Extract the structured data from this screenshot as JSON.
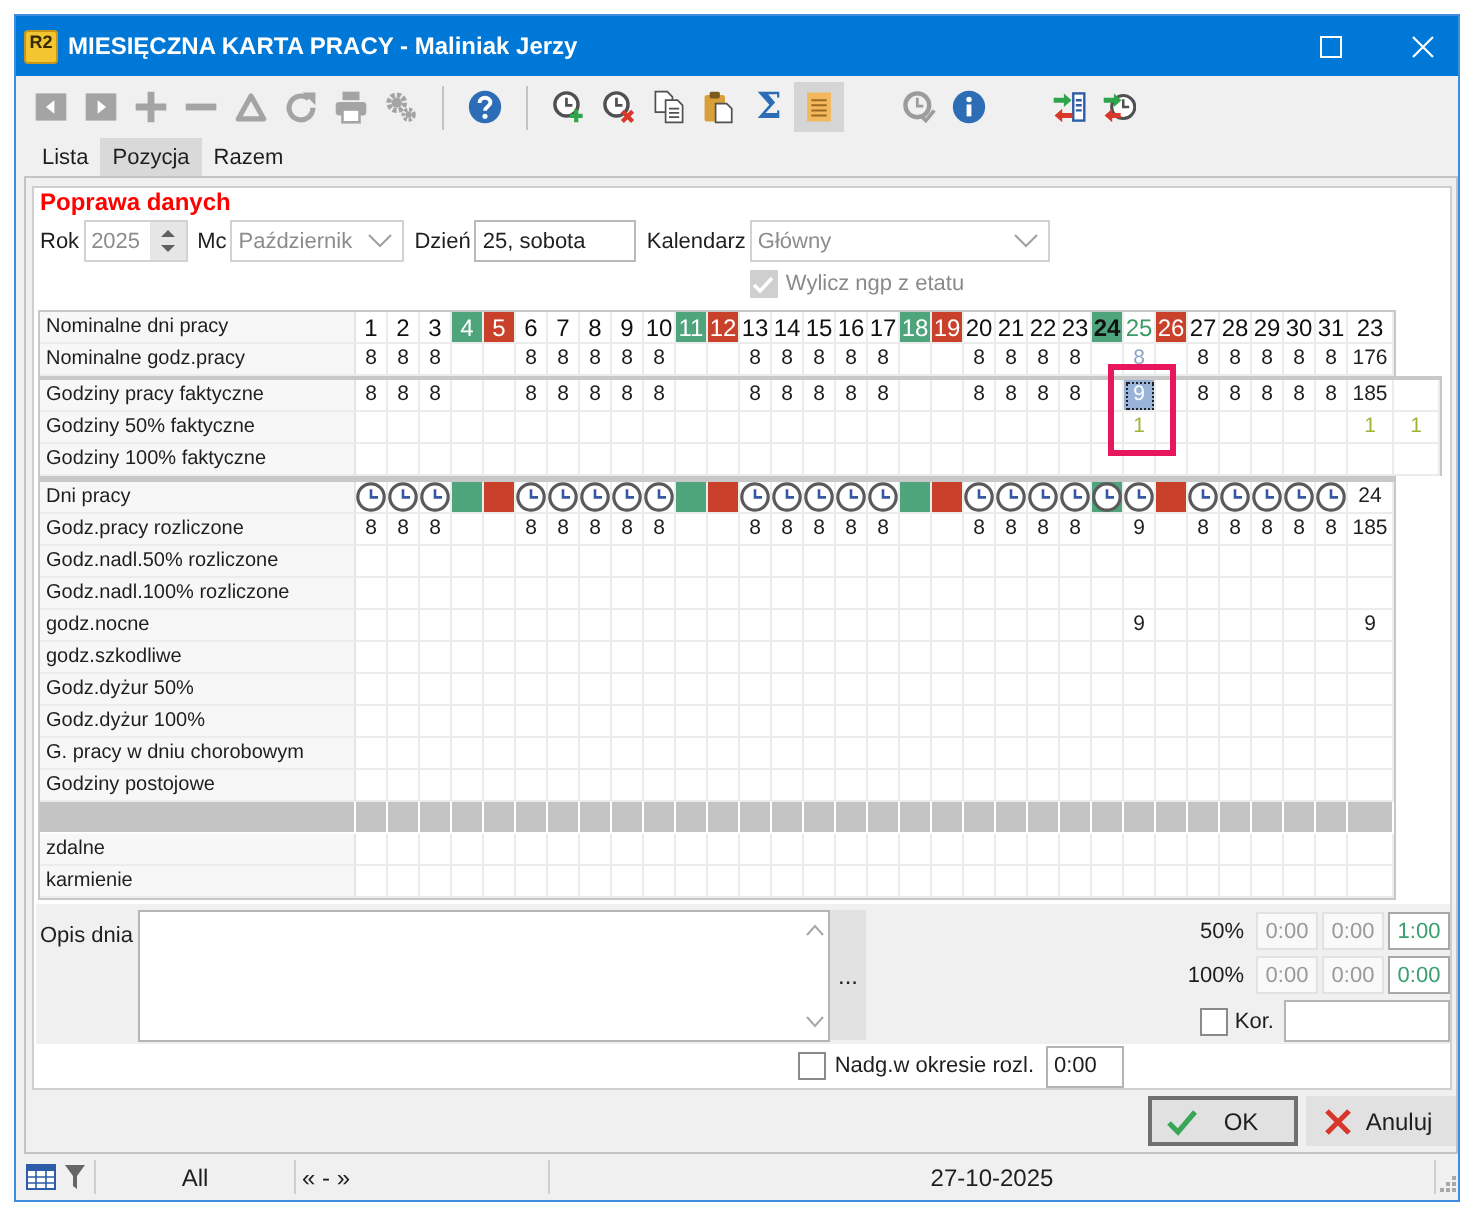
{
  "window": {
    "logo": "R2",
    "title": "MIESIĘCZNA KARTA PRACY - Maliniak Jerzy"
  },
  "toolbar": [
    {
      "kind": "prev",
      "disabled": true,
      "on": false
    },
    {
      "kind": "next",
      "disabled": true,
      "on": false
    },
    {
      "kind": "add",
      "disabled": true,
      "on": false
    },
    {
      "kind": "remove",
      "disabled": true,
      "on": false
    },
    {
      "kind": "delta",
      "disabled": true,
      "on": false
    },
    {
      "kind": "refresh",
      "disabled": true,
      "on": false
    },
    {
      "kind": "print",
      "disabled": true,
      "on": false
    },
    {
      "kind": "gears",
      "disabled": true,
      "on": false
    },
    {
      "kind": "separator"
    },
    {
      "kind": "help",
      "disabled": false,
      "on": false
    },
    {
      "kind": "separator"
    },
    {
      "kind": "clock_add",
      "disabled": false,
      "on": false
    },
    {
      "kind": "clock_remove",
      "disabled": false,
      "on": false
    },
    {
      "kind": "copy",
      "disabled": false,
      "on": false
    },
    {
      "kind": "paste",
      "disabled": false,
      "on": false
    },
    {
      "kind": "symbol",
      "text": "Σ",
      "disabled": false,
      "on": false
    },
    {
      "kind": "notes",
      "disabled": false,
      "on": true
    },
    {
      "kind": "spacer"
    },
    {
      "kind": "clock_check",
      "disabled": true,
      "on": false
    },
    {
      "kind": "info",
      "disabled": false,
      "on": false
    },
    {
      "kind": "spacer"
    },
    {
      "kind": "transfer_list",
      "disabled": false,
      "on": false
    },
    {
      "kind": "transfer_clock",
      "disabled": false,
      "on": false
    }
  ],
  "tabs": [
    {
      "label": "Lista",
      "selected": false
    },
    {
      "label": "Pozycja",
      "selected": true
    },
    {
      "label": "Razem",
      "selected": false
    }
  ],
  "form": {
    "heading": "Poprawa danych",
    "year": {
      "label": "Rok",
      "value": "2025",
      "disabled": true
    },
    "month": {
      "label": "Mc",
      "value": "Październik",
      "disabled": true
    },
    "day": {
      "label": "Dzień",
      "value": "25, sobota",
      "disabled": false
    },
    "calendar": {
      "label": "Kalendarz",
      "value": "Główny",
      "disabled": true
    },
    "ngp": {
      "label": "Wylicz ngp z etatu",
      "checked": true,
      "disabled": true
    }
  },
  "grid": {
    "days": [
      {
        "label": "1",
        "kind": "work",
        "selected": false,
        "marked": false,
        "hours": {
          "nominal": "8",
          "actual": "8",
          "settled": "8"
        }
      },
      {
        "label": "2",
        "kind": "work",
        "selected": false,
        "marked": false,
        "hours": {
          "nominal": "8",
          "actual": "8",
          "settled": "8"
        }
      },
      {
        "label": "3",
        "kind": "work",
        "selected": false,
        "marked": false,
        "hours": {
          "nominal": "8",
          "actual": "8",
          "settled": "8"
        }
      },
      {
        "label": "4",
        "kind": "free",
        "selected": false,
        "marked": false
      },
      {
        "label": "5",
        "kind": "holiday",
        "selected": false,
        "marked": false
      },
      {
        "label": "6",
        "kind": "work",
        "selected": false,
        "marked": false,
        "hours": {
          "nominal": "8",
          "actual": "8",
          "settled": "8"
        }
      },
      {
        "label": "7",
        "kind": "work",
        "selected": false,
        "marked": false,
        "hours": {
          "nominal": "8",
          "actual": "8",
          "settled": "8"
        }
      },
      {
        "label": "8",
        "kind": "work",
        "selected": false,
        "marked": false,
        "hours": {
          "nominal": "8",
          "actual": "8",
          "settled": "8"
        }
      },
      {
        "label": "9",
        "kind": "work",
        "selected": false,
        "marked": false,
        "hours": {
          "nominal": "8",
          "actual": "8",
          "settled": "8"
        }
      },
      {
        "label": "10",
        "kind": "work",
        "selected": false,
        "marked": false,
        "hours": {
          "nominal": "8",
          "actual": "8",
          "settled": "8"
        }
      },
      {
        "label": "11",
        "kind": "free",
        "selected": false,
        "marked": false
      },
      {
        "label": "12",
        "kind": "holiday",
        "selected": false,
        "marked": false
      },
      {
        "label": "13",
        "kind": "work",
        "selected": false,
        "marked": false,
        "hours": {
          "nominal": "8",
          "actual": "8",
          "settled": "8"
        }
      },
      {
        "label": "14",
        "kind": "work",
        "selected": false,
        "marked": false,
        "hours": {
          "nominal": "8",
          "actual": "8",
          "settled": "8"
        }
      },
      {
        "label": "15",
        "kind": "work",
        "selected": false,
        "marked": false,
        "hours": {
          "nominal": "8",
          "actual": "8",
          "settled": "8"
        }
      },
      {
        "label": "16",
        "kind": "work",
        "selected": false,
        "marked": false,
        "hours": {
          "nominal": "8",
          "actual": "8",
          "settled": "8"
        }
      },
      {
        "label": "17",
        "kind": "work",
        "selected": false,
        "marked": false,
        "hours": {
          "nominal": "8",
          "actual": "8",
          "settled": "8"
        }
      },
      {
        "label": "18",
        "kind": "free",
        "selected": false,
        "marked": false
      },
      {
        "label": "19",
        "kind": "holiday",
        "selected": false,
        "marked": false
      },
      {
        "label": "20",
        "kind": "work",
        "selected": false,
        "marked": false,
        "hours": {
          "nominal": "8",
          "actual": "8",
          "settled": "8"
        }
      },
      {
        "label": "21",
        "kind": "work",
        "selected": false,
        "marked": false,
        "hours": {
          "nominal": "8",
          "actual": "8",
          "settled": "8"
        }
      },
      {
        "label": "22",
        "kind": "work",
        "selected": false,
        "marked": false,
        "hours": {
          "nominal": "8",
          "actual": "8",
          "settled": "8"
        }
      },
      {
        "label": "23",
        "kind": "work",
        "selected": false,
        "marked": false,
        "hours": {
          "nominal": "8",
          "actual": "8",
          "settled": "8"
        }
      },
      {
        "label": "24",
        "kind": "swap_free",
        "selected": false,
        "marked": false
      },
      {
        "label": "25",
        "kind": "work",
        "selected": true,
        "marked": true,
        "hours": {
          "nominal": {
            "text": "8",
            "dim": true
          },
          "actual": {
            "text": "9",
            "selected": true
          },
          "overtime": "1",
          "settled": "9",
          "night": "9"
        }
      },
      {
        "label": "26",
        "kind": "holiday",
        "selected": false,
        "marked": false
      },
      {
        "label": "27",
        "kind": "work",
        "selected": false,
        "marked": false,
        "hours": {
          "nominal": "8",
          "actual": "8",
          "settled": "8"
        }
      },
      {
        "label": "28",
        "kind": "work",
        "selected": false,
        "marked": false,
        "hours": {
          "nominal": "8",
          "actual": "8",
          "settled": "8"
        }
      },
      {
        "label": "29",
        "kind": "work",
        "selected": false,
        "marked": false,
        "hours": {
          "nominal": "8",
          "actual": "8",
          "settled": "8"
        }
      },
      {
        "label": "30",
        "kind": "work",
        "selected": false,
        "marked": false,
        "hours": {
          "nominal": "8",
          "actual": "8",
          "settled": "8"
        }
      },
      {
        "label": "31",
        "kind": "work",
        "selected": false,
        "marked": false,
        "hours": {
          "nominal": "8",
          "actual": "8",
          "settled": "8"
        }
      }
    ],
    "sections": [
      {
        "rows": [
          {
            "label": "Nominalne dni pracy",
            "kind": "days",
            "total": "23"
          },
          {
            "label": "Nominalne godz.pracy",
            "kind": "nominal",
            "total": "176"
          }
        ]
      },
      {
        "rows": [
          {
            "label": "Godziny pracy faktyczne",
            "kind": "actual",
            "total": "185"
          },
          {
            "label": "Godziny 50% faktyczne",
            "kind": "overtime",
            "total": "1",
            "extra": "1"
          },
          {
            "label": "Godziny 100% faktyczne",
            "kind": "plain"
          }
        ]
      },
      {
        "rows": [
          {
            "label": "Dni pracy",
            "kind": "marks",
            "total": "24"
          },
          {
            "label": "Godz.pracy rozliczone",
            "kind": "settled",
            "total": "185"
          },
          {
            "label": "Godz.nadl.50% rozliczone",
            "kind": "plain"
          },
          {
            "label": "Godz.nadl.100% rozliczone",
            "kind": "plain"
          },
          {
            "label": "godz.nocne",
            "kind": "night",
            "total": "9"
          },
          {
            "label": "godz.szkodliwe",
            "kind": "plain"
          },
          {
            "label": "Godz.dyżur 50%",
            "kind": "plain"
          },
          {
            "label": "Godz.dyżur 100%",
            "kind": "plain"
          },
          {
            "label": "G. pracy w dniu chorobowym",
            "kind": "plain"
          },
          {
            "label": "Godziny postojowe",
            "kind": "plain"
          },
          {
            "kind": "blank"
          },
          {
            "label": "zdalne",
            "kind": "plain"
          },
          {
            "label": "karmienie",
            "kind": "plain"
          }
        ]
      }
    ]
  },
  "bottom": {
    "description": {
      "label": "Opis dnia",
      "button": "..."
    },
    "overtime": [
      {
        "label": "50%",
        "values": [
          "0:00",
          "0:00",
          "1:00"
        ]
      },
      {
        "label": "100%",
        "values": [
          "0:00",
          "0:00",
          "0:00"
        ]
      }
    ],
    "correction": {
      "label": "Kor.",
      "checked": false
    },
    "period": {
      "label": "Nadg.w okresie rozl.",
      "checked": false,
      "value": "0:00"
    }
  },
  "buttons": [
    {
      "kind": "ok",
      "label": "OK",
      "default": true
    },
    {
      "kind": "cancel",
      "label": "Anuluj",
      "default": false
    }
  ],
  "status_bar": {
    "filter": "All",
    "nav": "« - »",
    "date": "27-10-2025"
  }
}
